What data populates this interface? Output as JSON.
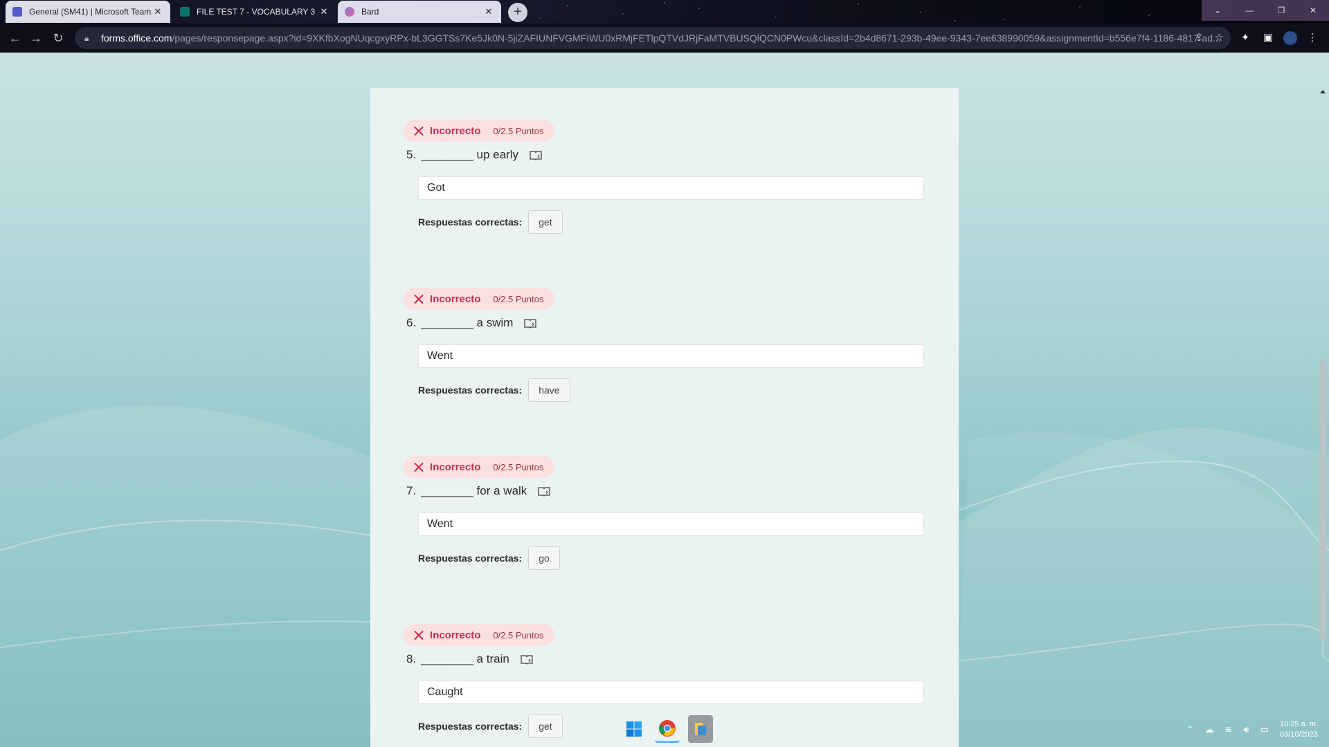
{
  "browser": {
    "tabs": [
      {
        "title": "General (SM41) | Microsoft Team...",
        "favicon_color": "#5059c9",
        "active": false
      },
      {
        "title": "FILE TEST 7 - VOCABULARY 3",
        "favicon_color": "#077568",
        "active": true
      },
      {
        "title": "Bard",
        "favicon_color": "#8a7bd6",
        "active": false
      }
    ],
    "new_tab_label": "+",
    "url_host": "forms.office.com",
    "url_path": "/pages/responsepage.aspx?id=9XKfbXogNUqcgxyRPx-bL3GGTSs7Ke5Jk0N-5jiZAFIUNFVGMFIWU0xRMjFETlpQTVdJRjFaMTVBUSQlQCN0PWcu&classId=2b4d8671-293b-49ee-9343-7ee638990059&assignmentId=b556e7f4-1186-4817-ad..."
  },
  "questions": [
    {
      "status": "Incorrecto",
      "points": "0/2.5 Puntos",
      "number": "5.",
      "text": "________ up early",
      "answer": "Got",
      "correct_label": "Respuestas correctas:",
      "correct": "get"
    },
    {
      "status": "Incorrecto",
      "points": "0/2.5 Puntos",
      "number": "6.",
      "text": "________ a swim",
      "answer": "Went",
      "correct_label": "Respuestas correctas:",
      "correct": "have"
    },
    {
      "status": "Incorrecto",
      "points": "0/2.5 Puntos",
      "number": "7.",
      "text": "________ for a walk",
      "answer": "Went",
      "correct_label": "Respuestas correctas:",
      "correct": "go"
    },
    {
      "status": "Incorrecto",
      "points": "0/2.5 Puntos",
      "number": "8.",
      "text": "________ a train",
      "answer": "Caught",
      "correct_label": "Respuestas correctas:",
      "correct": "get"
    }
  ],
  "taskbar": {
    "clock_time": "10:25 a. m.",
    "clock_date": "03/10/2023"
  },
  "colors": {
    "incorrect": "#c4314b",
    "badge_bg": "#fbe0e2"
  }
}
